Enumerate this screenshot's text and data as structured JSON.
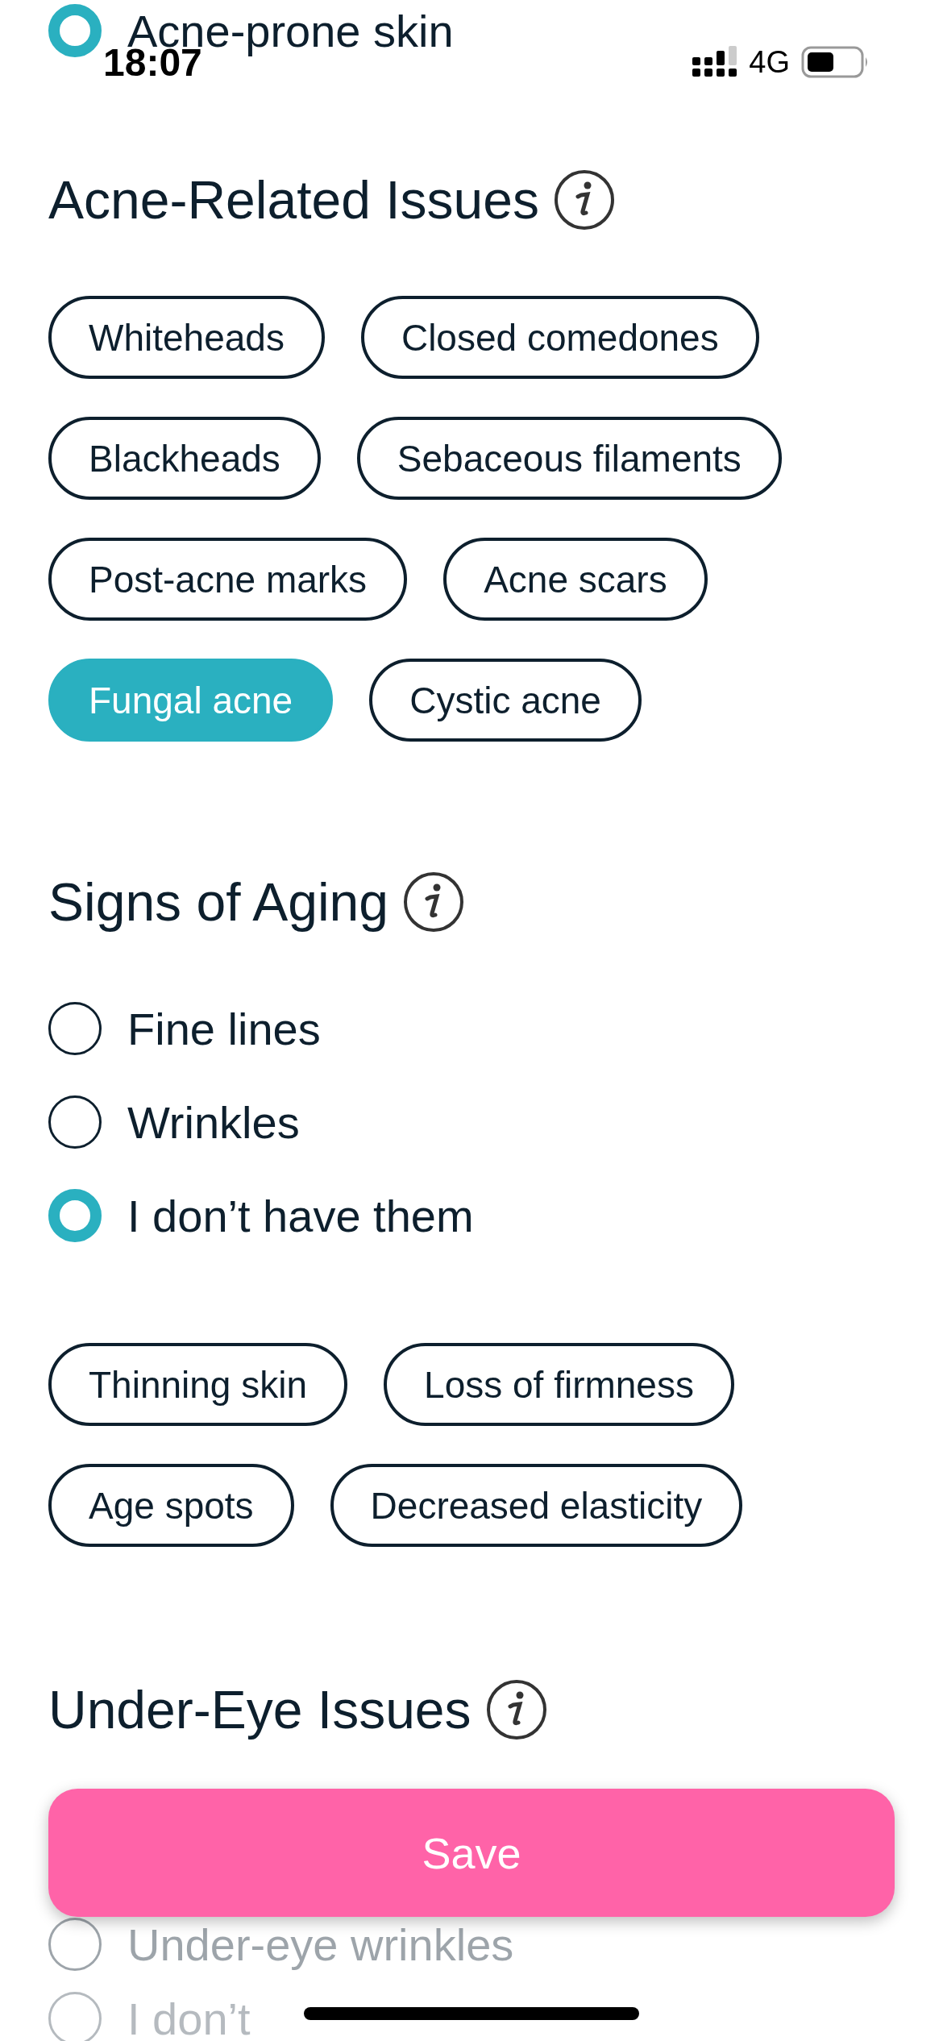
{
  "status_bar": {
    "time": "18:07",
    "network": "4G"
  },
  "top_option": {
    "label": "Acne-prone skin",
    "selected": true
  },
  "sections": [
    {
      "title": "Acne-Related Issues",
      "blocks": [
        {
          "kind": "chips",
          "items": [
            {
              "label": "Whiteheads",
              "selected": false
            },
            {
              "label": "Closed comedones",
              "selected": false
            },
            {
              "label": "Blackheads",
              "selected": false
            },
            {
              "label": "Sebaceous filaments",
              "selected": false
            },
            {
              "label": "Post-acne marks",
              "selected": false
            },
            {
              "label": "Acne scars",
              "selected": false
            },
            {
              "label": "Fungal acne",
              "selected": true
            },
            {
              "label": "Cystic acne",
              "selected": false
            }
          ]
        }
      ]
    },
    {
      "title": "Signs of Aging",
      "blocks": [
        {
          "kind": "radios",
          "items": [
            {
              "label": "Fine lines",
              "selected": false
            },
            {
              "label": "Wrinkles",
              "selected": false
            },
            {
              "label": "I don’t have them",
              "selected": true
            }
          ]
        },
        {
          "kind": "chips",
          "items": [
            {
              "label": "Thinning skin",
              "selected": false
            },
            {
              "label": "Loss of firmness",
              "selected": false
            },
            {
              "label": "Age spots",
              "selected": false
            },
            {
              "label": "Decreased elasticity",
              "selected": false
            }
          ]
        }
      ]
    },
    {
      "title": "Under-Eye Issues",
      "blocks": [
        {
          "kind": "faded_radios",
          "items": [
            {
              "label": "Under-eye wrinkles",
              "selected": false
            },
            {
              "label": "I don’t",
              "selected": false
            }
          ]
        }
      ]
    }
  ],
  "save_button": {
    "label": "Save"
  }
}
